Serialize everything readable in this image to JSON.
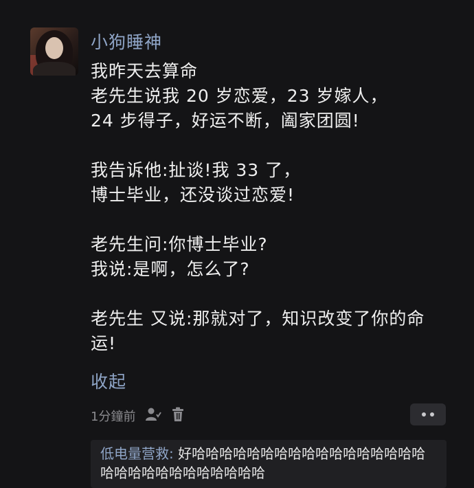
{
  "comment": {
    "username": "小狗睡神",
    "avatar_icon": "user-avatar-photo",
    "post_lines": [
      "我昨天去算命",
      "老先生说我 20 岁恋爱，23 岁嫁人，",
      "24 步得子，好运不断，阖家团圆!",
      "",
      "我告诉他:扯谈!我 33 了，",
      "博士毕业，还没谈过恋爱!",
      "",
      "老先生问:你博士毕业?",
      "我说:是啊，怎么了?",
      "",
      "老先生 又说:那就对了，知识改变了你的命",
      "运!"
    ],
    "collapse_label": "收起",
    "timestamp": "1分鐘前",
    "mention_icon": "person-icon",
    "delete_icon": "trash-icon",
    "more_icon": "more-dots-icon"
  },
  "reply": {
    "name": "低电量营救",
    "separator": ": ",
    "text": "好哈哈哈哈哈哈哈哈哈哈哈哈哈哈哈哈哈哈哈哈哈哈哈哈哈哈哈哈哈"
  }
}
